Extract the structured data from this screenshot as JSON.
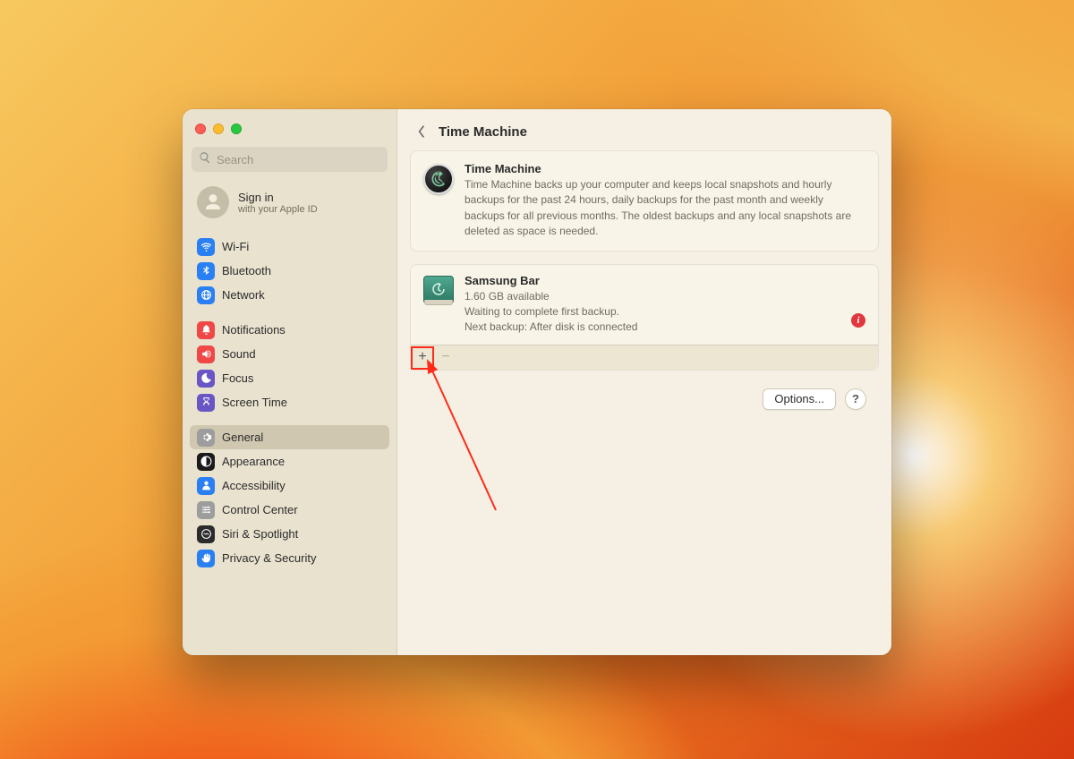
{
  "header": {
    "title": "Time Machine"
  },
  "search": {
    "placeholder": "Search",
    "value": ""
  },
  "signin": {
    "title": "Sign in",
    "subtitle": "with your Apple ID"
  },
  "sidebar": {
    "groups": [
      {
        "items": [
          {
            "label": "Wi-Fi",
            "iconBg": "#2a7ff3",
            "icon": "wifi"
          },
          {
            "label": "Bluetooth",
            "iconBg": "#2a7ff3",
            "icon": "bluetooth"
          },
          {
            "label": "Network",
            "iconBg": "#2a7ff3",
            "icon": "globe"
          }
        ]
      },
      {
        "items": [
          {
            "label": "Notifications",
            "iconBg": "#ef4846",
            "icon": "bell"
          },
          {
            "label": "Sound",
            "iconBg": "#ef4846",
            "icon": "speaker"
          },
          {
            "label": "Focus",
            "iconBg": "#6a55c5",
            "icon": "moon"
          },
          {
            "label": "Screen Time",
            "iconBg": "#6a55c5",
            "icon": "hourglass"
          }
        ]
      },
      {
        "items": [
          {
            "label": "General",
            "iconBg": "#9d9d9d",
            "icon": "gear",
            "selected": true
          },
          {
            "label": "Appearance",
            "iconBg": "#1b1b1b",
            "icon": "contrast"
          },
          {
            "label": "Accessibility",
            "iconBg": "#2a7ff3",
            "icon": "person"
          },
          {
            "label": "Control Center",
            "iconBg": "#9d9d9d",
            "icon": "sliders"
          },
          {
            "label": "Siri & Spotlight",
            "iconBg": "#2b2b2b",
            "icon": "siri"
          },
          {
            "label": "Privacy & Security",
            "iconBg": "#2a7ff3",
            "icon": "hand"
          }
        ]
      }
    ]
  },
  "panel_info": {
    "title": "Time Machine",
    "desc": "Time Machine backs up your computer and keeps local snapshots and hourly backups for the past 24 hours, daily backups for the past month and weekly backups for all previous months. The oldest backups and any local snapshots are deleted as space is needed."
  },
  "disk": {
    "name": "Samsung Bar",
    "available": "1.60 GB available",
    "status": "Waiting to complete first backup.",
    "next": "Next backup: After disk is connected"
  },
  "controls": {
    "plus": "+",
    "minus": "−"
  },
  "footer": {
    "options": "Options...",
    "help": "?"
  },
  "info_badge": "i"
}
